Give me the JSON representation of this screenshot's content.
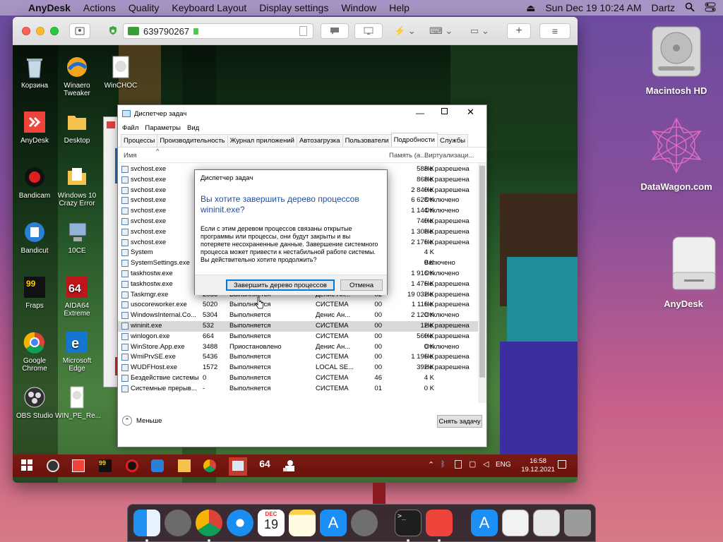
{
  "menubar": {
    "app": "AnyDesk",
    "items": [
      "Actions",
      "Quality",
      "Keyboard Layout",
      "Display settings",
      "Window",
      "Help"
    ],
    "datetime": "Sun Dec 19  10:24 AM",
    "user": "Dartz"
  },
  "desktop_icons": [
    {
      "label": "Macintosh HD",
      "icon": "hard-drive-icon"
    },
    {
      "label": "DataWagon.com",
      "icon": "datawagon-logo-icon"
    },
    {
      "label": "AnyDesk",
      "icon": "external-drive-icon"
    }
  ],
  "anydesk": {
    "address": "639790267",
    "address_icon": "monitor-icon"
  },
  "remote_icons": [
    {
      "label": "Корзина",
      "icon": "recycle-bin-icon"
    },
    {
      "label": "Winaero Tweaker",
      "icon": "winaero-icon"
    },
    {
      "label": "WinCHOC",
      "icon": "winchoc-icon"
    },
    {
      "label": "AnyDesk",
      "icon": "anydesk-icon"
    },
    {
      "label": "Desktop",
      "icon": "folder-icon"
    },
    {
      "label": "Bandicam",
      "icon": "bandicam-icon"
    },
    {
      "label": "Windows 10 Crazy Error",
      "icon": "folder-icon"
    },
    {
      "label": "Bandicut",
      "icon": "bandicut-icon"
    },
    {
      "label": "10CE",
      "icon": "computer-icon"
    },
    {
      "label": "Fraps",
      "icon": "fraps-icon"
    },
    {
      "label": "AIDA64 Extreme",
      "icon": "aida64-icon"
    },
    {
      "label": "Google Chrome",
      "icon": "chrome-icon"
    },
    {
      "label": "Microsoft Edge",
      "icon": "edge-icon"
    },
    {
      "label": "OBS Studio",
      "icon": "obs-icon"
    },
    {
      "label": "WIN_PE_Re...",
      "icon": "file-icon"
    }
  ],
  "taskmgr": {
    "title": "Диспетчер задач",
    "menu": [
      "Файл",
      "Параметры",
      "Вид"
    ],
    "tabs": [
      "Процессы",
      "Производительность",
      "Журнал приложений",
      "Автозагрузка",
      "Пользователи",
      "Подробности",
      "Службы"
    ],
    "selected_tab": "Подробности",
    "headers": {
      "name": "Имя",
      "memory": "Память (а...",
      "virt": "Виртуализаци..."
    },
    "rows": [
      {
        "name": "svchost.exe",
        "pid": "",
        "status": "",
        "user": "",
        "cpu": "",
        "mem": "588 K",
        "virt": "Не разрешена"
      },
      {
        "name": "svchost.exe",
        "pid": "",
        "status": "",
        "user": "",
        "cpu": "",
        "mem": "868 K",
        "virt": "Не разрешена"
      },
      {
        "name": "svchost.exe",
        "pid": "",
        "status": "",
        "user": "",
        "cpu": "",
        "mem": "2 840 K",
        "virt": "Не разрешена"
      },
      {
        "name": "svchost.exe",
        "pid": "",
        "status": "",
        "user": "",
        "cpu": "",
        "mem": "6 628 K",
        "virt": "Отключено"
      },
      {
        "name": "svchost.exe",
        "pid": "",
        "status": "",
        "user": "",
        "cpu": "",
        "mem": "1 144 K",
        "virt": "Отключено"
      },
      {
        "name": "svchost.exe",
        "pid": "",
        "status": "",
        "user": "",
        "cpu": "",
        "mem": "740 K",
        "virt": "Не разрешена"
      },
      {
        "name": "svchost.exe",
        "pid": "",
        "status": "",
        "user": "",
        "cpu": "",
        "mem": "1 308 K",
        "virt": "Не разрешена"
      },
      {
        "name": "svchost.exe",
        "pid": "",
        "status": "",
        "user": "",
        "cpu": "",
        "mem": "2 176 K",
        "virt": "Не разрешена"
      },
      {
        "name": "System",
        "pid": "",
        "status": "",
        "user": "",
        "cpu": "",
        "mem": "4 K",
        "virt": ""
      },
      {
        "name": "SystemSettings.exe",
        "pid": "",
        "status": "",
        "user": "",
        "cpu": "",
        "mem": "0 K",
        "virt": "Включено"
      },
      {
        "name": "taskhostw.exe",
        "pid": "",
        "status": "",
        "user": "",
        "cpu": "",
        "mem": "1 916 K",
        "virt": "Отключено"
      },
      {
        "name": "taskhostw.exe",
        "pid": "8076",
        "status": "Выполняется",
        "user": "Денис Ан...",
        "cpu": "00",
        "mem": "1 476 K",
        "virt": "Не разрешена"
      },
      {
        "name": "Taskmgr.exe",
        "pid": "2036",
        "status": "Выполняется",
        "user": "Денис Ан...",
        "cpu": "02",
        "mem": "19 032 K",
        "virt": "Не разрешена"
      },
      {
        "name": "usocoreworker.exe",
        "pid": "5020",
        "status": "Выполняется",
        "user": "СИСТЕМА",
        "cpu": "00",
        "mem": "1 116 K",
        "virt": "Не разрешена"
      },
      {
        "name": "WindowsInternal.Co...",
        "pid": "5304",
        "status": "Выполняется",
        "user": "Денис Ан...",
        "cpu": "00",
        "mem": "2 120 K",
        "virt": "Отключено"
      },
      {
        "name": "wininit.exe",
        "pid": "532",
        "status": "Выполняется",
        "user": "СИСТЕМА",
        "cpu": "00",
        "mem": "12 K",
        "virt": "Не разрешена"
      },
      {
        "name": "winlogon.exe",
        "pid": "664",
        "status": "Выполняется",
        "user": "СИСТЕМА",
        "cpu": "00",
        "mem": "560 K",
        "virt": "Не разрешена"
      },
      {
        "name": "WinStore.App.exe",
        "pid": "3488",
        "status": "Приостановлено",
        "user": "Денис Ан...",
        "cpu": "00",
        "mem": "0 K",
        "virt": "Отключено"
      },
      {
        "name": "WmiPrvSE.exe",
        "pid": "5436",
        "status": "Выполняется",
        "user": "СИСТЕМА",
        "cpu": "00",
        "mem": "1 196 K",
        "virt": "Не разрешена"
      },
      {
        "name": "WUDFHost.exe",
        "pid": "1572",
        "status": "Выполняется",
        "user": "LOCAL SE...",
        "cpu": "00",
        "mem": "392 K",
        "virt": "Не разрешена"
      },
      {
        "name": "Бездействие системы",
        "pid": "0",
        "status": "Выполняется",
        "user": "СИСТЕМА",
        "cpu": "46",
        "mem": "4 K",
        "virt": ""
      },
      {
        "name": "Системные прерыв...",
        "pid": "-",
        "status": "Выполняется",
        "user": "СИСТЕМА",
        "cpu": "01",
        "mem": "0 K",
        "virt": ""
      }
    ],
    "selected_row": 15,
    "less_label": "Меньше",
    "end_task_label": "Снять задачу"
  },
  "dialog": {
    "title": "Диспетчер задач",
    "heading": "Вы хотите завершить дерево процессов wininit.exe?",
    "body": "Если с этим деревом процессов связаны открытые программы или процессы, они будут закрыты и вы потеряете несохраненные данные. Завершение системного процесса может привести к нестабильной работе системы. Вы действительно хотите продолжить?",
    "confirm": "Завершить дерево процессов",
    "cancel": "Отмена"
  },
  "win_taskbar": {
    "lang": "ENG",
    "time": "16:58",
    "date": "19.12.2021",
    "apps": [
      "obs-icon",
      "anydesk-icon",
      "fraps-icon",
      "bandicam-icon",
      "bandicut-icon",
      "folder-icon",
      "chrome-icon",
      "taskmgr-icon",
      "aida64-icon",
      "users-icon"
    ],
    "aida_label": "64"
  },
  "dock": {
    "apps": [
      "finder-icon",
      "launchpad-icon",
      "chrome-icon",
      "safari-icon",
      "calendar-icon",
      "notes-icon",
      "app-store-icon",
      "system-preferences-icon",
      "terminal-icon",
      "anydesk-icon",
      "app-store-folder-icon",
      "downloads-icon",
      "screenshot-icon",
      "trash-icon"
    ],
    "calendar_month": "DEC",
    "calendar_day": "19"
  }
}
